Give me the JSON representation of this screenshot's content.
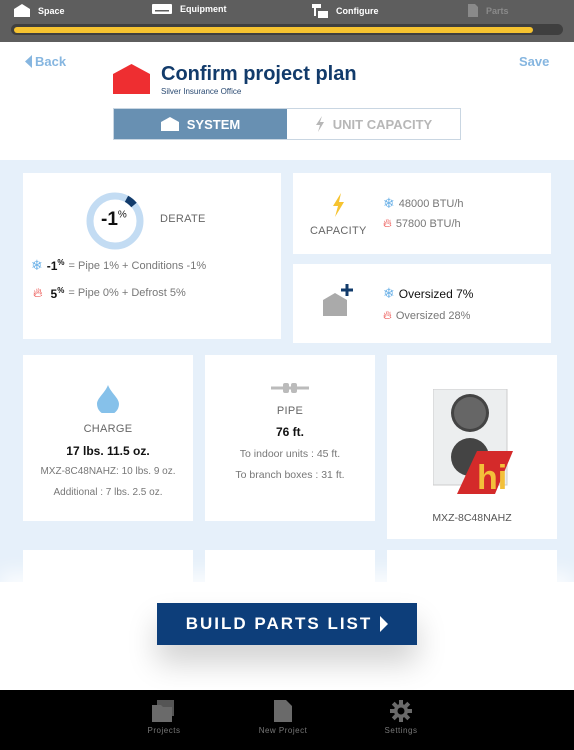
{
  "steps": [
    {
      "label": "Space",
      "icon": "house-icon"
    },
    {
      "label": "Equipment",
      "icon": "indoor-unit-icon"
    },
    {
      "label": "Configure",
      "icon": "configure-icon"
    },
    {
      "label": "Parts",
      "icon": "document-icon"
    }
  ],
  "progress_percent": 95,
  "header": {
    "back": "Back",
    "save": "Save",
    "title": "Confirm project plan",
    "subtitle": "Silver Insurance Office"
  },
  "tabs": [
    {
      "label": "SYSTEM",
      "active": true
    },
    {
      "label": "UNIT CAPACITY",
      "active": false
    }
  ],
  "derate": {
    "value": "-1",
    "unit": "%",
    "label": "DERATE",
    "cool_value": "-1",
    "cool_unit": "%",
    "cool_detail": "= Pipe 1% + Conditions -1%",
    "heat_value": "5",
    "heat_unit": "%",
    "heat_detail": "= Pipe 0% + Defrost 5%"
  },
  "capacity": {
    "label": "CAPACITY",
    "cool": "48000 BTU/h",
    "heat": "57800 BTU/h"
  },
  "oversized": {
    "cool": "Oversized 7%",
    "heat": "Oversized 28%"
  },
  "charge": {
    "label": "CHARGE",
    "total": "17 lbs. 11.5 oz.",
    "unit_line": "MXZ-8C48NAHZ: 10 lbs. 9 oz.",
    "additional": "Additional : 7 lbs. 2.5 oz."
  },
  "pipe": {
    "label": "PIPE",
    "total": "76 ft.",
    "indoor": "To indoor units : 45 ft.",
    "branch": "To branch boxes : 31 ft."
  },
  "unit": {
    "model": "MXZ-8C48NAHZ",
    "badge": "h2i"
  },
  "build_button": "BUILD PARTS LIST",
  "nav": [
    {
      "label": "Projects",
      "icon": "folder-icon"
    },
    {
      "label": "New Project",
      "icon": "new-document-icon"
    },
    {
      "label": "Settings",
      "icon": "gear-icon"
    }
  ],
  "colors": {
    "accent": "#0d3e7a",
    "progress": "#f6c330",
    "cool": "#6fb3e8",
    "heat": "#e8302c",
    "brand_red": "#ee2e31"
  }
}
